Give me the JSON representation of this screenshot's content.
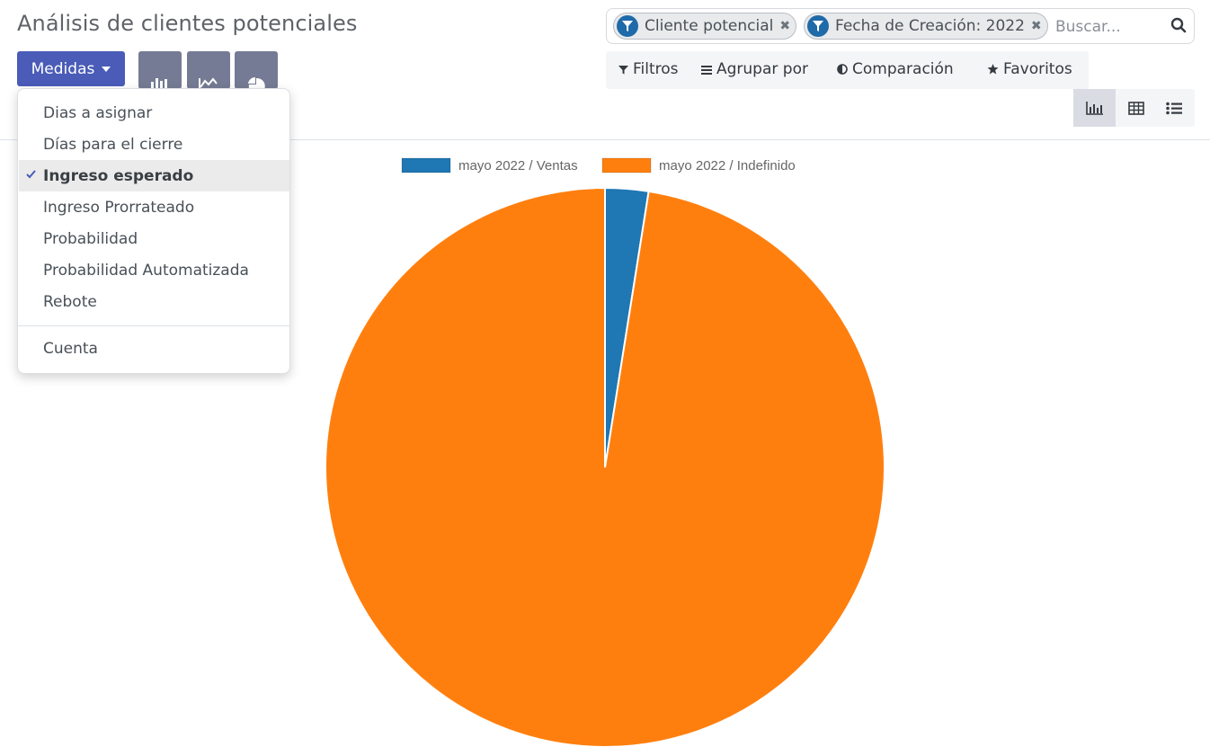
{
  "header": {
    "title": "Análisis de clientes potenciales"
  },
  "toolbar": {
    "measures_label": "Medidas",
    "chart_types": [
      "bar-chart-icon",
      "line-chart-icon",
      "pie-chart-icon"
    ]
  },
  "search": {
    "facets": [
      {
        "label": "Cliente potencial",
        "icon": "filter-icon"
      },
      {
        "label": "Fecha de Creación: 2022",
        "icon": "filter-icon"
      }
    ],
    "placeholder": "Buscar..."
  },
  "filter_bar": {
    "filters": "Filtros",
    "group_by": "Agrupar por",
    "comparison": "Comparación",
    "favorites": "Favoritos"
  },
  "views": [
    "graph-view-icon",
    "pivot-view-icon",
    "list-view-icon"
  ],
  "measures_menu": {
    "items": [
      {
        "label": "Dias a asignar",
        "checked": false
      },
      {
        "label": "Días para el cierre",
        "checked": false
      },
      {
        "label": "Ingreso esperado",
        "checked": true
      },
      {
        "label": "Ingreso Prorrateado",
        "checked": false
      },
      {
        "label": "Probabilidad",
        "checked": false
      },
      {
        "label": "Probabilidad Automatizada",
        "checked": false
      },
      {
        "label": "Rebote",
        "checked": false
      }
    ],
    "count_item": "Cuenta"
  },
  "colors": {
    "primary": "#4a5cb8",
    "series_1": "#1f77b4",
    "series_2": "#ff7f0e"
  },
  "chart_data": {
    "type": "pie",
    "series": [
      {
        "name": "mayo 2022 / Ventas",
        "value": 2.5
      },
      {
        "name": "mayo 2022 / Indefinido",
        "value": 97.5
      }
    ],
    "legend_position": "top"
  }
}
